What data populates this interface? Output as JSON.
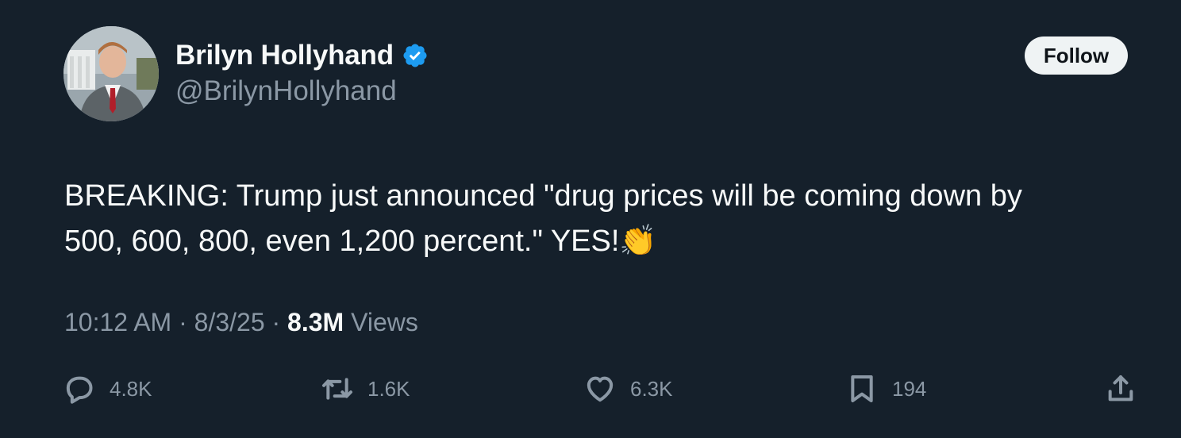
{
  "author": {
    "display_name": "Brilyn Hollyhand",
    "handle": "@BrilynHollyhand",
    "verified": true,
    "avatar_icon": "profile-photo"
  },
  "follow_button": {
    "label": "Follow"
  },
  "tweet": {
    "text": "BREAKING: Trump just announced \"drug prices will be coming down by\n500, 600, 800, even 1,200 percent.\" YES!👏",
    "time": "10:12 AM",
    "separator": " · ",
    "date": "8/3/25",
    "views_count": "8.3M",
    "views_label": " Views"
  },
  "actions": {
    "reply": {
      "icon": "reply-icon",
      "count": "4.8K"
    },
    "retweet": {
      "icon": "retweet-icon",
      "count": "1.6K"
    },
    "like": {
      "icon": "heart-icon",
      "count": "6.3K"
    },
    "bookmark": {
      "icon": "bookmark-icon",
      "count": "194"
    },
    "share": {
      "icon": "share-icon"
    }
  },
  "colors": {
    "background": "#15202b",
    "primary_text": "#f7f9f9",
    "secondary_text": "#8b98a5",
    "verified_blue": "#1d9bf0",
    "follow_bg": "#eff3f4"
  }
}
